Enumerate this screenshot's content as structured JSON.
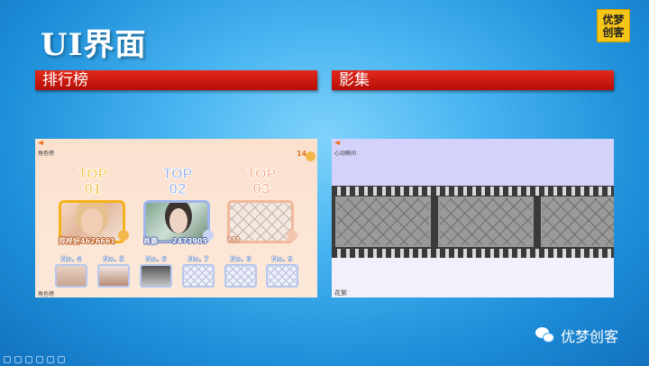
{
  "slide": {
    "title": "UI界面",
    "logo_lines": [
      "优梦",
      "创客"
    ]
  },
  "sections": {
    "left_header": "排行榜",
    "right_header": "影集"
  },
  "leaderboard": {
    "header_small": "角色榜",
    "footer_small": "角色榜",
    "counter": "14",
    "top3": [
      {
        "word": "TOP",
        "num": "01",
        "color": "#f5b724",
        "label": "郑梓妍4626661"
      },
      {
        "word": "TOP",
        "num": "02",
        "color": "#8ca6e8",
        "label": "肖鹿——2473905"
      },
      {
        "word": "TOP",
        "num": "03",
        "color": "#f0a07a",
        "label": "???"
      }
    ],
    "ranks": [
      {
        "no": "No. 4",
        "filled": true
      },
      {
        "no": "No. 5",
        "filled": true
      },
      {
        "no": "No. 6",
        "filled": true
      },
      {
        "no": "No. 7",
        "filled": false
      },
      {
        "no": "No. 8",
        "filled": false
      },
      {
        "no": "No. 9",
        "filled": false
      }
    ]
  },
  "album": {
    "header_small": "心动瞬间",
    "footer_small": "花絮"
  },
  "watermark": {
    "text": "优梦创客"
  },
  "icons": [
    "back-arrow-icon",
    "bear-icon",
    "wechat-icon"
  ]
}
